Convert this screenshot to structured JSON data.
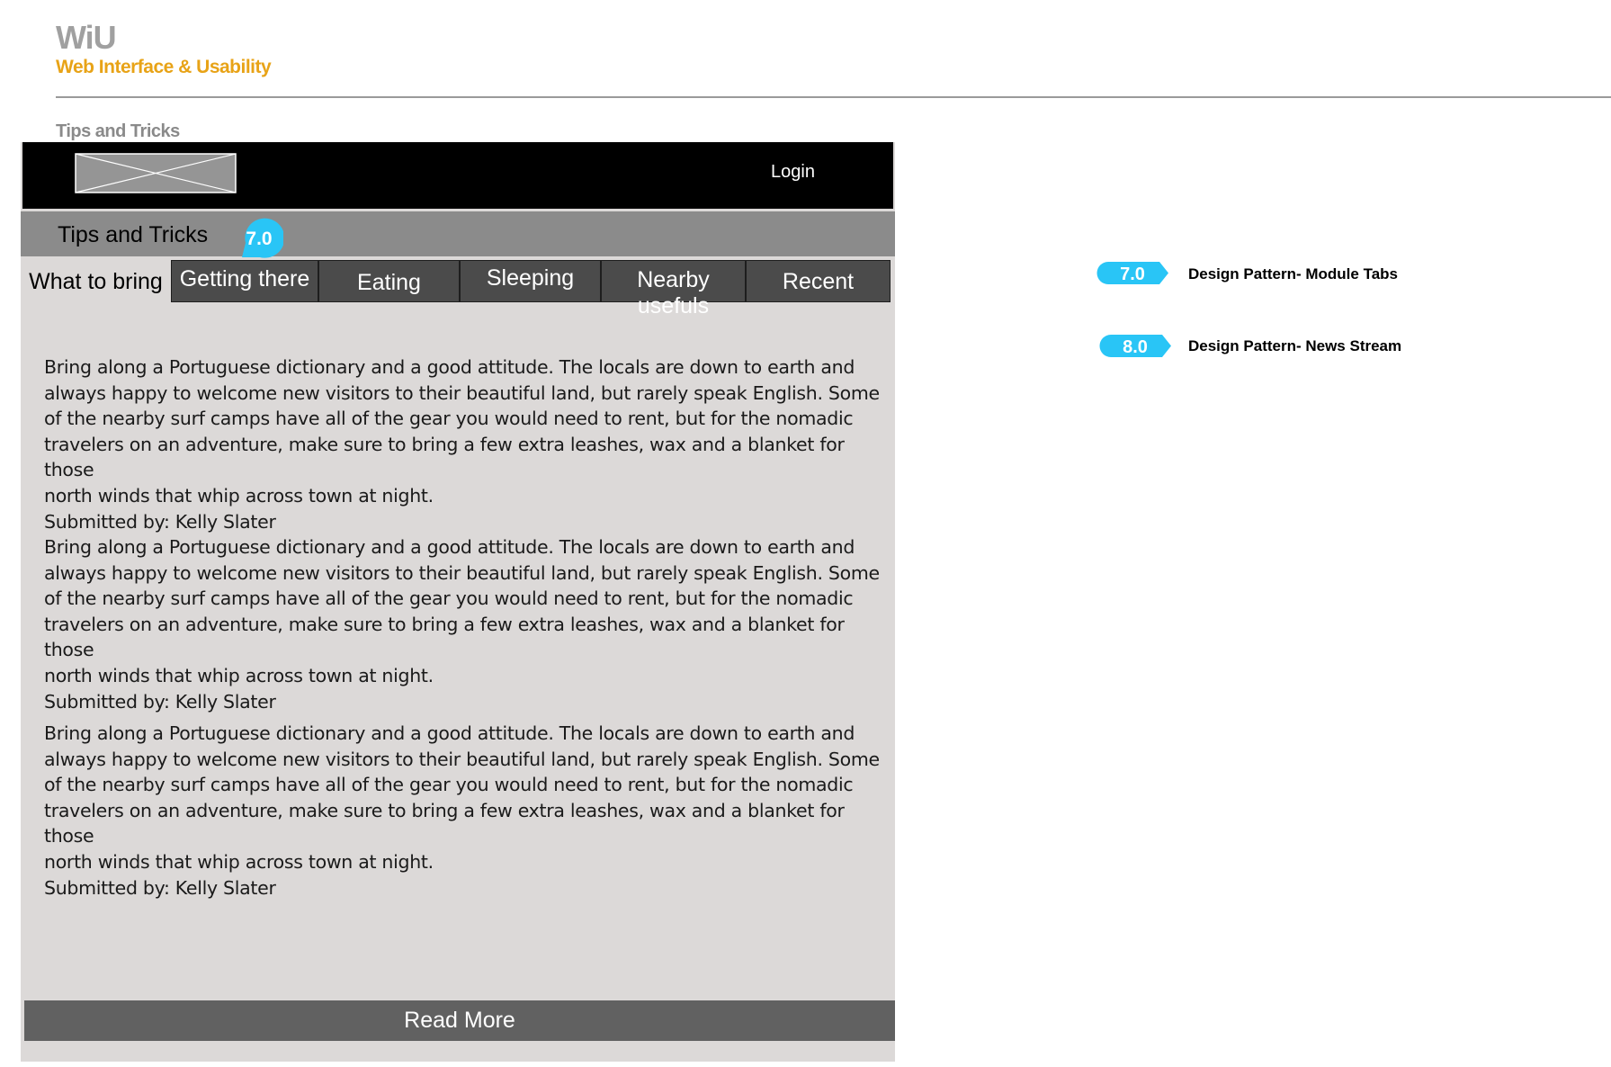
{
  "header": {
    "brand": "WiU",
    "subtitle": "Web Interface & Usability",
    "section": "Tips and Tricks"
  },
  "wireframe": {
    "topbar": {
      "logo": "logo-placeholder",
      "login_label": "Login"
    },
    "module": {
      "title": "Tips and Tricks",
      "callout": "7.0"
    },
    "tabs": [
      {
        "label": "What to bring",
        "active": true
      },
      {
        "label": "Getting there",
        "active": false
      },
      {
        "label": "Eating",
        "active": false
      },
      {
        "label": "Sleeping",
        "active": false
      },
      {
        "label": "Nearby usefuls",
        "active": false
      },
      {
        "label": "Recent",
        "active": false
      }
    ],
    "posts": [
      {
        "lines": [
          "Bring along a Portuguese dictionary and a good attitude. The locals are down to earth and",
          "always happy to welcome new visitors to their beautiful land, but rarely speak English. Some",
          "of the nearby surf camps have all of the gear you would need to rent, but for the nomadic",
          "travelers on an adventure, make sure to bring a few extra leashes, wax and a blanket for those",
          "north winds that whip across town at night."
        ],
        "submitted": "Submitted by: Kelly Slater"
      },
      {
        "lines": [
          "Bring along a Portuguese dictionary and a good attitude. The locals are down to earth and",
          "always happy to welcome new visitors to their beautiful land, but rarely speak English. Some",
          "of the nearby surf camps have all of the gear you would need to rent, but for the nomadic",
          "travelers on an adventure, make sure to bring a few extra leashes, wax and a blanket for those",
          "north winds that whip across town at night."
        ],
        "submitted": "Submitted by: Kelly Slater"
      },
      {
        "lines": [
          "Bring along a Portuguese dictionary and a good attitude. The locals are down to earth and",
          "always happy to welcome new visitors to their beautiful land, but rarely speak English. Some",
          "of the nearby surf camps have all of the gear you would need to rent, but for the nomadic",
          "travelers on an adventure, make sure to bring a few extra leashes, wax and a blanket for those",
          "north winds that whip across town at night."
        ],
        "submitted": "Submitted by: Kelly Slater"
      }
    ],
    "read_more_label": "Read More"
  },
  "legend": [
    {
      "badge": "7.0",
      "text": "Design Pattern- Module Tabs"
    },
    {
      "badge": "8.0",
      "text": "Design Pattern- News Stream"
    }
  ],
  "colors": {
    "brand_gray": "#a0a0a0",
    "accent_orange": "#e8a317",
    "callout_blue": "#29c5f6",
    "panel_gray": "#dcd9d8",
    "tab_dark": "#4b4b4b",
    "module_bar": "#8b8b8b"
  }
}
